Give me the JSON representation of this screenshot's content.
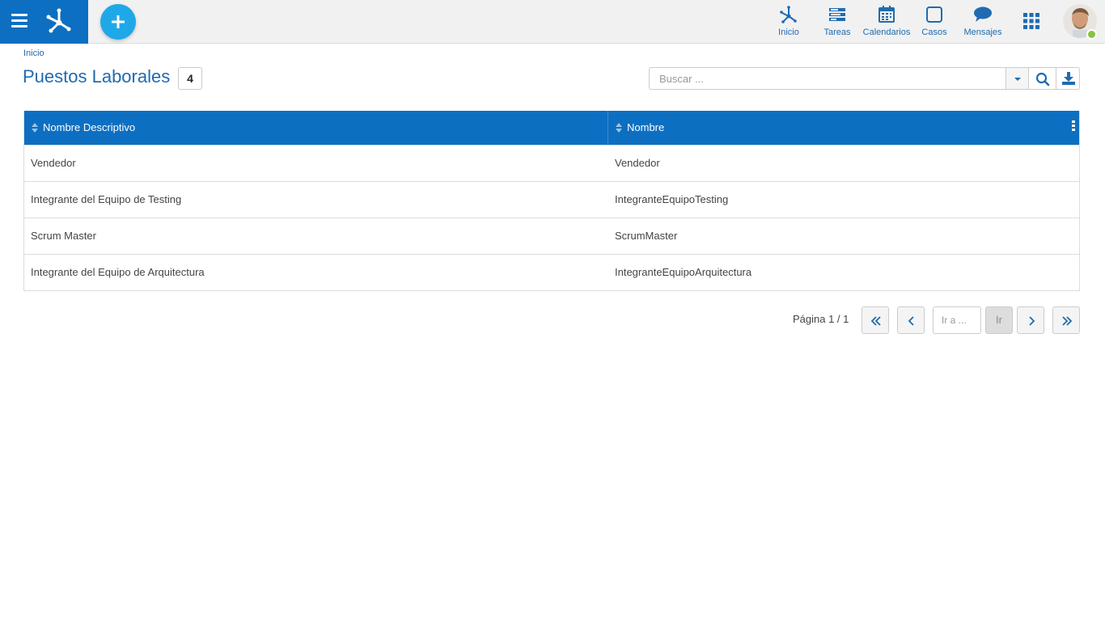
{
  "topbar": {
    "nav": [
      {
        "label": "Inicio",
        "icon": "home-network-icon"
      },
      {
        "label": "Tareas",
        "icon": "tasks-icon"
      },
      {
        "label": "Calendarios",
        "icon": "calendar-icon"
      },
      {
        "label": "Casos",
        "icon": "cases-icon"
      },
      {
        "label": "Mensajes",
        "icon": "chat-bubble-icon"
      }
    ]
  },
  "header": {
    "breadcrumb": "Inicio",
    "title": "Puestos Laborales",
    "count": "4"
  },
  "search": {
    "placeholder": "Buscar ..."
  },
  "table": {
    "columns": [
      "Nombre Descriptivo",
      "Nombre"
    ],
    "rows": [
      [
        "Vendedor",
        "Vendedor"
      ],
      [
        "Integrante del Equipo de Testing",
        "IntegranteEquipoTesting"
      ],
      [
        "Scrum Master",
        "ScrumMaster"
      ],
      [
        "Integrante del Equipo de Arquitectura",
        "IntegranteEquipoArquitectura"
      ]
    ]
  },
  "pagination": {
    "info": "Página 1 / 1",
    "goto_placeholder": "Ir a ...",
    "go_label": "Ir"
  },
  "colors": {
    "primary": "#0d6fc1",
    "accent": "#1fa8e8",
    "link": "#1f6bb0",
    "online": "#86c440"
  }
}
